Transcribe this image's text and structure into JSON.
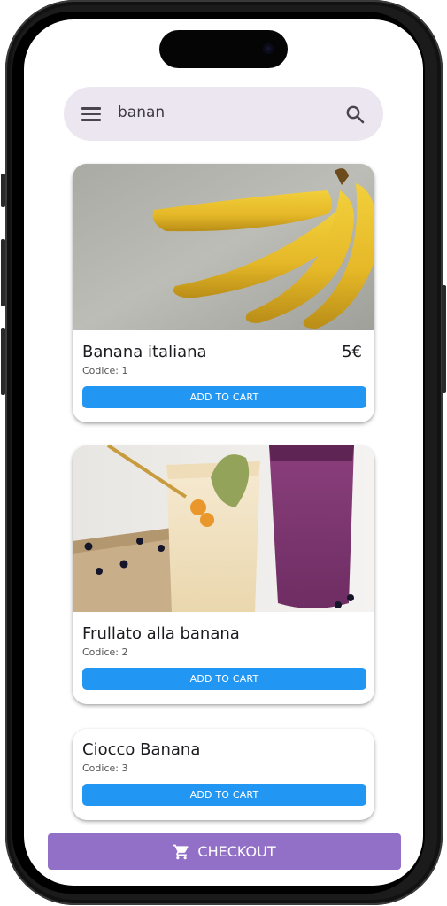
{
  "search": {
    "query": "banan"
  },
  "products": [
    {
      "name": "Banana italiana",
      "price": "5€",
      "code": "Codice: 1",
      "button": "ADD TO CART"
    },
    {
      "name": "Frullato alla banana",
      "price": "",
      "code": "Codice: 2",
      "button": "ADD TO CART"
    },
    {
      "name": "Ciocco Banana",
      "price": "",
      "code": "Codice: 3",
      "button": "ADD TO CART"
    }
  ],
  "checkout": {
    "label": "CHECKOUT"
  },
  "colors": {
    "accent": "#2196f3",
    "checkout": "#9270c8",
    "search_bg": "#ece6f0"
  },
  "icons": {
    "menu": "menu-icon",
    "search": "search-icon",
    "cart": "cart-icon"
  }
}
